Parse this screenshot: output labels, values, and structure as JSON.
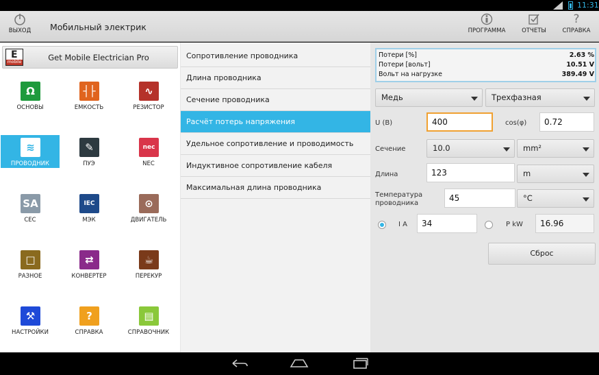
{
  "status": {
    "time": "11:31"
  },
  "actionbar": {
    "exit_label": "ВЫХОД",
    "title": "Мобильный электрик",
    "program_label": "ПРОГРАММА",
    "reports_label": "ОТЧЕТЫ",
    "help_label": "СПРАВКА"
  },
  "left": {
    "pro_label": "Get Mobile Electrician Pro",
    "logo_letter": "E",
    "logo_text": "mobile",
    "items": [
      {
        "label": "ОСНОВЫ",
        "glyph": "Ω",
        "color": "#1e9a3c",
        "icon": "omega-icon"
      },
      {
        "label": "ЕМКОСТЬ",
        "glyph": "┤├",
        "color": "#e0641e",
        "icon": "capacitor-icon"
      },
      {
        "label": "РЕЗИСТОР",
        "glyph": "∿",
        "color": "#b5322a",
        "icon": "resistor-icon"
      },
      {
        "label": "ПРОВОДНИК",
        "glyph": "≋",
        "color": "#ffffff",
        "icon": "cable-icon"
      },
      {
        "label": "ПУЭ",
        "glyph": "✎",
        "color": "#2d3a40",
        "icon": "reader-icon"
      },
      {
        "label": "NEC",
        "glyph": "nec",
        "color": "#d9354a",
        "icon": "nec-icon"
      },
      {
        "label": "CEC",
        "glyph": "SA",
        "color": "#8a9aa8",
        "icon": "csa-icon"
      },
      {
        "label": "МЭК",
        "glyph": "IEC",
        "color": "#1e4a8a",
        "icon": "iec-icon"
      },
      {
        "label": "ДВИГАТЕЛЬ",
        "glyph": "⊙",
        "color": "#9a6b5a",
        "icon": "motor-icon"
      },
      {
        "label": "РАЗНОЕ",
        "glyph": "□",
        "color": "#8a6a1e",
        "icon": "misc-icon"
      },
      {
        "label": "КОНВЕРТЕР",
        "glyph": "⇄",
        "color": "#8a2a8a",
        "icon": "converter-icon"
      },
      {
        "label": "ПЕРЕКУР",
        "glyph": "☕",
        "color": "#7a3a1a",
        "icon": "coffee-icon"
      },
      {
        "label": "НАСТРОЙКИ",
        "glyph": "⚒",
        "color": "#1e4ad8",
        "icon": "tools-icon"
      },
      {
        "label": "СПРАВКА",
        "glyph": "?",
        "color": "#f0a01e",
        "icon": "question-icon"
      },
      {
        "label": "СПРАВОЧНИК",
        "glyph": "▤",
        "color": "#8ac83a",
        "icon": "book-icon"
      }
    ]
  },
  "middle": {
    "items": [
      "Сопротивление проводника",
      "Длина проводника",
      "Сечение проводника",
      "Расчёт потерь напряжения",
      "Удельное сопротивление и проводимость",
      "Индуктивное сопротивление кабеля",
      "Максимальная длина проводника"
    ]
  },
  "results": {
    "loss_pct_label": "Потери [%]",
    "loss_pct_value": "2.63 %",
    "loss_v_label": "Потери [вольт]",
    "loss_v_value": "10.51 V",
    "load_v_label": "Вольт на нагрузке",
    "load_v_value": "389.49 V"
  },
  "form": {
    "material": "Медь",
    "phase": "Трехфазная",
    "u_label": "U (B)",
    "u_value": "400",
    "cos_label": "cos(φ)",
    "cos_value": "0.72",
    "section_label": "Сечение",
    "section_value": "10.0",
    "section_unit": "mm²",
    "length_label": "Длина",
    "length_value": "123",
    "length_unit": "m",
    "temp_label": "Температура проводника",
    "temp_value": "45",
    "temp_unit": "°C",
    "current_label": "I A",
    "current_value": "34",
    "power_label": "P kW",
    "power_value": "16.96",
    "reset_label": "Сброс"
  }
}
